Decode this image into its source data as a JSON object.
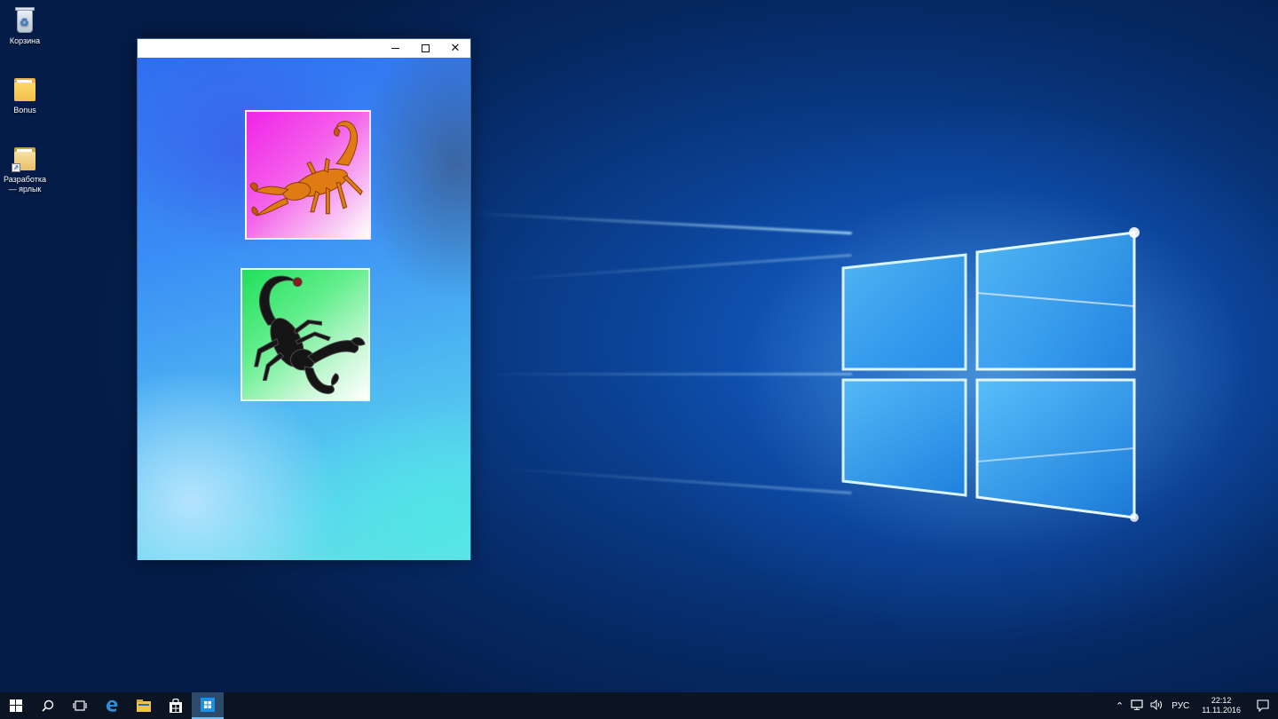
{
  "desktop": {
    "icons": [
      {
        "label": "Корзина",
        "icon": "recycle-bin-icon"
      },
      {
        "label": "Bonus",
        "icon": "folder-icon"
      },
      {
        "label": "Разработка — ярлык",
        "icon": "folder-shortcut-icon"
      }
    ]
  },
  "window": {
    "title": "",
    "controls": {
      "minimize": "minimize-icon",
      "maximize": "maximize-icon",
      "close": "close-icon"
    },
    "cards": [
      {
        "name": "scorpion-orange-card",
        "background": "#f024e8"
      },
      {
        "name": "scorpion-black-card",
        "background": "#1fe05a"
      }
    ]
  },
  "taskbar": {
    "items": [
      "start-icon",
      "search-icon",
      "task-view-icon",
      "edge-icon",
      "file-explorer-icon",
      "store-icon",
      "app-icon"
    ],
    "tray": {
      "language": "РУС",
      "time": "22:12",
      "date": "11.11.2016"
    }
  },
  "colors": {
    "wallpaper": "#0a3f8f",
    "taskbar": "#0a1422",
    "accent": "#76b9ed"
  }
}
